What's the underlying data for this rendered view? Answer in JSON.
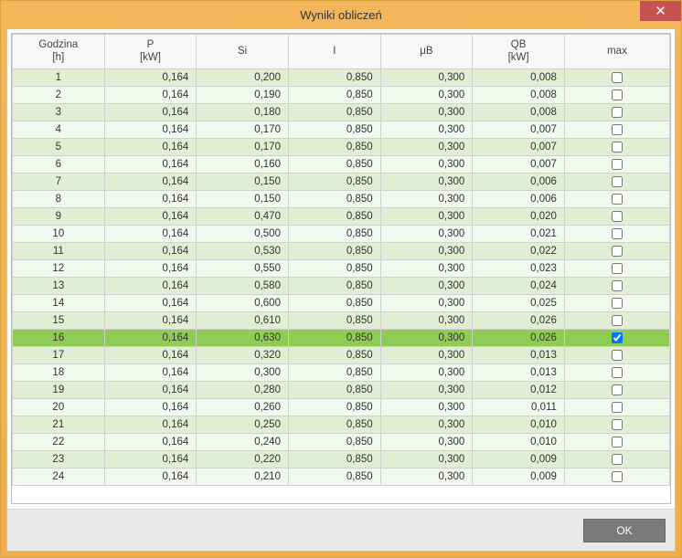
{
  "window": {
    "title": "Wyniki obliczeń"
  },
  "buttons": {
    "close": "✕",
    "ok": "OK"
  },
  "columns": {
    "hour": "Godzina\n[h]",
    "p": "P\n[kW]",
    "si": "Si",
    "i": "I",
    "ub": "μB",
    "qb": "QB\n[kW]",
    "max": "max"
  },
  "selected_row": 16,
  "rows": [
    {
      "hour": 1,
      "p": "0,164",
      "si": "0,200",
      "i": "0,850",
      "ub": "0,300",
      "qb": "0,008",
      "max": false
    },
    {
      "hour": 2,
      "p": "0,164",
      "si": "0,190",
      "i": "0,850",
      "ub": "0,300",
      "qb": "0,008",
      "max": false
    },
    {
      "hour": 3,
      "p": "0,164",
      "si": "0,180",
      "i": "0,850",
      "ub": "0,300",
      "qb": "0,008",
      "max": false
    },
    {
      "hour": 4,
      "p": "0,164",
      "si": "0,170",
      "i": "0,850",
      "ub": "0,300",
      "qb": "0,007",
      "max": false
    },
    {
      "hour": 5,
      "p": "0,164",
      "si": "0,170",
      "i": "0,850",
      "ub": "0,300",
      "qb": "0,007",
      "max": false
    },
    {
      "hour": 6,
      "p": "0,164",
      "si": "0,160",
      "i": "0,850",
      "ub": "0,300",
      "qb": "0,007",
      "max": false
    },
    {
      "hour": 7,
      "p": "0,164",
      "si": "0,150",
      "i": "0,850",
      "ub": "0,300",
      "qb": "0,006",
      "max": false
    },
    {
      "hour": 8,
      "p": "0,164",
      "si": "0,150",
      "i": "0,850",
      "ub": "0,300",
      "qb": "0,006",
      "max": false
    },
    {
      "hour": 9,
      "p": "0,164",
      "si": "0,470",
      "i": "0,850",
      "ub": "0,300",
      "qb": "0,020",
      "max": false
    },
    {
      "hour": 10,
      "p": "0,164",
      "si": "0,500",
      "i": "0,850",
      "ub": "0,300",
      "qb": "0,021",
      "max": false
    },
    {
      "hour": 11,
      "p": "0,164",
      "si": "0,530",
      "i": "0,850",
      "ub": "0,300",
      "qb": "0,022",
      "max": false
    },
    {
      "hour": 12,
      "p": "0,164",
      "si": "0,550",
      "i": "0,850",
      "ub": "0,300",
      "qb": "0,023",
      "max": false
    },
    {
      "hour": 13,
      "p": "0,164",
      "si": "0,580",
      "i": "0,850",
      "ub": "0,300",
      "qb": "0,024",
      "max": false
    },
    {
      "hour": 14,
      "p": "0,164",
      "si": "0,600",
      "i": "0,850",
      "ub": "0,300",
      "qb": "0,025",
      "max": false
    },
    {
      "hour": 15,
      "p": "0,164",
      "si": "0,610",
      "i": "0,850",
      "ub": "0,300",
      "qb": "0,026",
      "max": false
    },
    {
      "hour": 16,
      "p": "0,164",
      "si": "0,630",
      "i": "0,850",
      "ub": "0,300",
      "qb": "0,026",
      "max": true
    },
    {
      "hour": 17,
      "p": "0,164",
      "si": "0,320",
      "i": "0,850",
      "ub": "0,300",
      "qb": "0,013",
      "max": false
    },
    {
      "hour": 18,
      "p": "0,164",
      "si": "0,300",
      "i": "0,850",
      "ub": "0,300",
      "qb": "0,013",
      "max": false
    },
    {
      "hour": 19,
      "p": "0,164",
      "si": "0,280",
      "i": "0,850",
      "ub": "0,300",
      "qb": "0,012",
      "max": false
    },
    {
      "hour": 20,
      "p": "0,164",
      "si": "0,260",
      "i": "0,850",
      "ub": "0,300",
      "qb": "0,011",
      "max": false
    },
    {
      "hour": 21,
      "p": "0,164",
      "si": "0,250",
      "i": "0,850",
      "ub": "0,300",
      "qb": "0,010",
      "max": false
    },
    {
      "hour": 22,
      "p": "0,164",
      "si": "0,240",
      "i": "0,850",
      "ub": "0,300",
      "qb": "0,010",
      "max": false
    },
    {
      "hour": 23,
      "p": "0,164",
      "si": "0,220",
      "i": "0,850",
      "ub": "0,300",
      "qb": "0,009",
      "max": false
    },
    {
      "hour": 24,
      "p": "0,164",
      "si": "0,210",
      "i": "0,850",
      "ub": "0,300",
      "qb": "0,009",
      "max": false
    }
  ]
}
